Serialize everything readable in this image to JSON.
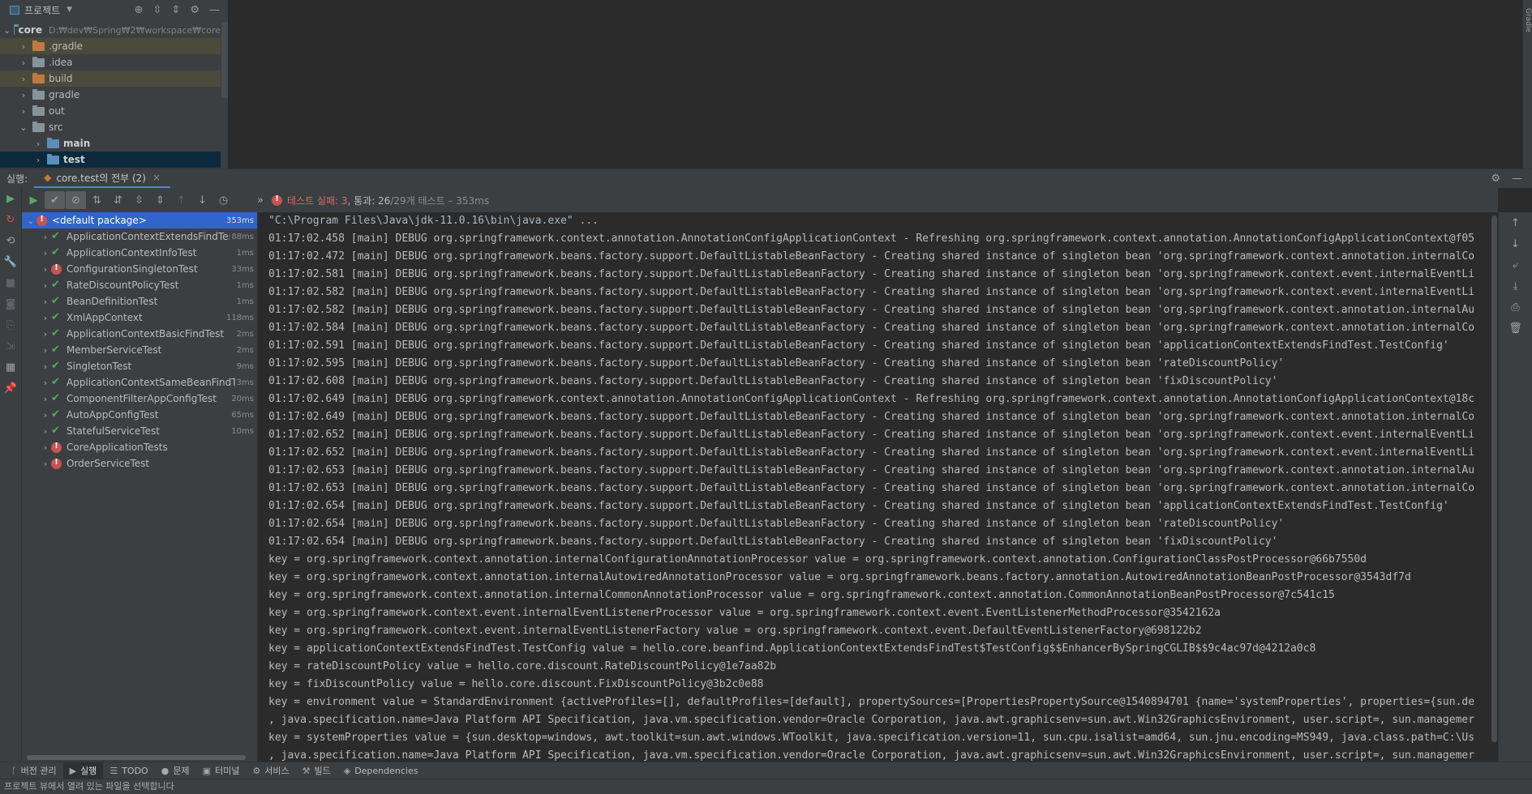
{
  "project_panel": {
    "title": "프로젝트",
    "tree": [
      {
        "label": "core",
        "path": "D:₩dev₩Spring₩2₩workspace₩core",
        "level": 0,
        "expanded": true,
        "folder": "blue",
        "bold": true
      },
      {
        "label": ".gradle",
        "level": 1,
        "expanded": false,
        "folder": "orange",
        "highlight": true
      },
      {
        "label": ".idea",
        "level": 1,
        "expanded": false,
        "folder": "gray"
      },
      {
        "label": "build",
        "level": 1,
        "expanded": false,
        "folder": "orange",
        "highlight": true
      },
      {
        "label": "gradle",
        "level": 1,
        "expanded": false,
        "folder": "gray"
      },
      {
        "label": "out",
        "level": 1,
        "expanded": false,
        "folder": "gray"
      },
      {
        "label": "src",
        "level": 1,
        "expanded": true,
        "folder": "gray"
      },
      {
        "label": "main",
        "level": 2,
        "expanded": false,
        "folder": "blue",
        "bold": true
      },
      {
        "label": "test",
        "level": 2,
        "expanded": false,
        "folder": "blue",
        "bold": true,
        "selected": true
      }
    ]
  },
  "right_strip": {
    "label": "Gradle"
  },
  "run_window": {
    "label": "실행:",
    "tab_label": "core.test의 전부 (2)",
    "status": {
      "failed": "테스트 실패: 3",
      "passed": ", 통과: 26",
      "total": " /29개 테스트 – 353ms"
    },
    "tests": [
      {
        "name": "<default package>",
        "time": "353ms",
        "status": "fail",
        "level": 0,
        "expanded": true,
        "selected": true
      },
      {
        "name": "ApplicationContextExtendsFindTest",
        "time": "88ms",
        "status": "pass",
        "level": 1
      },
      {
        "name": "ApplicationContextInfoTest",
        "time": "1ms",
        "status": "pass",
        "level": 1
      },
      {
        "name": "ConfigurationSingletonTest",
        "time": "33ms",
        "status": "fail",
        "level": 1
      },
      {
        "name": "RateDiscountPolicyTest",
        "time": "1ms",
        "status": "pass",
        "level": 1
      },
      {
        "name": "BeanDefinitionTest",
        "time": "1ms",
        "status": "pass",
        "level": 1
      },
      {
        "name": "XmlAppContext",
        "time": "118ms",
        "status": "pass",
        "level": 1
      },
      {
        "name": "ApplicationContextBasicFindTest",
        "time": "2ms",
        "status": "pass",
        "level": 1
      },
      {
        "name": "MemberServiceTest",
        "time": "2ms",
        "status": "pass",
        "level": 1
      },
      {
        "name": "SingletonTest",
        "time": "9ms",
        "status": "pass",
        "level": 1
      },
      {
        "name": "ApplicationContextSameBeanFindTest",
        "time": "3ms",
        "status": "pass",
        "level": 1
      },
      {
        "name": "ComponentFilterAppConfigTest",
        "time": "20ms",
        "status": "pass",
        "level": 1
      },
      {
        "name": "AutoAppConfigTest",
        "time": "65ms",
        "status": "pass",
        "level": 1
      },
      {
        "name": "StatefulServiceTest",
        "time": "10ms",
        "status": "pass",
        "level": 1
      },
      {
        "name": "CoreApplicationTests",
        "time": "",
        "status": "fail",
        "level": 1
      },
      {
        "name": "OrderServiceTest",
        "time": "",
        "status": "fail",
        "level": 1
      }
    ],
    "console": [
      "\"C:\\Program Files\\Java\\jdk-11.0.16\\bin\\java.exe\" ...",
      "01:17:02.458 [main] DEBUG org.springframework.context.annotation.AnnotationConfigApplicationContext - Refreshing org.springframework.context.annotation.AnnotationConfigApplicationContext@f05",
      "01:17:02.472 [main] DEBUG org.springframework.beans.factory.support.DefaultListableBeanFactory - Creating shared instance of singleton bean 'org.springframework.context.annotation.internalCo",
      "01:17:02.581 [main] DEBUG org.springframework.beans.factory.support.DefaultListableBeanFactory - Creating shared instance of singleton bean 'org.springframework.context.event.internalEventLi",
      "01:17:02.582 [main] DEBUG org.springframework.beans.factory.support.DefaultListableBeanFactory - Creating shared instance of singleton bean 'org.springframework.context.event.internalEventLi",
      "01:17:02.582 [main] DEBUG org.springframework.beans.factory.support.DefaultListableBeanFactory - Creating shared instance of singleton bean 'org.springframework.context.annotation.internalAu",
      "01:17:02.584 [main] DEBUG org.springframework.beans.factory.support.DefaultListableBeanFactory - Creating shared instance of singleton bean 'org.springframework.context.annotation.internalCo",
      "01:17:02.591 [main] DEBUG org.springframework.beans.factory.support.DefaultListableBeanFactory - Creating shared instance of singleton bean 'applicationContextExtendsFindTest.TestConfig'",
      "01:17:02.595 [main] DEBUG org.springframework.beans.factory.support.DefaultListableBeanFactory - Creating shared instance of singleton bean 'rateDiscountPolicy'",
      "01:17:02.608 [main] DEBUG org.springframework.beans.factory.support.DefaultListableBeanFactory - Creating shared instance of singleton bean 'fixDiscountPolicy'",
      "01:17:02.649 [main] DEBUG org.springframework.context.annotation.AnnotationConfigApplicationContext - Refreshing org.springframework.context.annotation.AnnotationConfigApplicationContext@18c",
      "01:17:02.649 [main] DEBUG org.springframework.beans.factory.support.DefaultListableBeanFactory - Creating shared instance of singleton bean 'org.springframework.context.annotation.internalCo",
      "01:17:02.652 [main] DEBUG org.springframework.beans.factory.support.DefaultListableBeanFactory - Creating shared instance of singleton bean 'org.springframework.context.event.internalEventLi",
      "01:17:02.652 [main] DEBUG org.springframework.beans.factory.support.DefaultListableBeanFactory - Creating shared instance of singleton bean 'org.springframework.context.event.internalEventLi",
      "01:17:02.653 [main] DEBUG org.springframework.beans.factory.support.DefaultListableBeanFactory - Creating shared instance of singleton bean 'org.springframework.context.annotation.internalAu",
      "01:17:02.653 [main] DEBUG org.springframework.beans.factory.support.DefaultListableBeanFactory - Creating shared instance of singleton bean 'org.springframework.context.annotation.internalCo",
      "01:17:02.654 [main] DEBUG org.springframework.beans.factory.support.DefaultListableBeanFactory - Creating shared instance of singleton bean 'applicationContextExtendsFindTest.TestConfig'",
      "01:17:02.654 [main] DEBUG org.springframework.beans.factory.support.DefaultListableBeanFactory - Creating shared instance of singleton bean 'rateDiscountPolicy'",
      "01:17:02.654 [main] DEBUG org.springframework.beans.factory.support.DefaultListableBeanFactory - Creating shared instance of singleton bean 'fixDiscountPolicy'",
      "key = org.springframework.context.annotation.internalConfigurationAnnotationProcessor value = org.springframework.context.annotation.ConfigurationClassPostProcessor@66b7550d",
      "key = org.springframework.context.annotation.internalAutowiredAnnotationProcessor value = org.springframework.beans.factory.annotation.AutowiredAnnotationBeanPostProcessor@3543df7d",
      "key = org.springframework.context.annotation.internalCommonAnnotationProcessor value = org.springframework.context.annotation.CommonAnnotationBeanPostProcessor@7c541c15",
      "key = org.springframework.context.event.internalEventListenerProcessor value = org.springframework.context.event.EventListenerMethodProcessor@3542162a",
      "key = org.springframework.context.event.internalEventListenerFactory value = org.springframework.context.event.DefaultEventListenerFactory@698122b2",
      "key = applicationContextExtendsFindTest.TestConfig value = hello.core.beanfind.ApplicationContextExtendsFindTest$TestConfig$$EnhancerBySpringCGLIB$$9c4ac97d@4212a0c8",
      "key = rateDiscountPolicy value = hello.core.discount.RateDiscountPolicy@1e7aa82b",
      "key = fixDiscountPolicy value = hello.core.discount.FixDiscountPolicy@3b2c0e88",
      "key = environment value = StandardEnvironment {activeProfiles=[], defaultProfiles=[default], propertySources=[PropertiesPropertySource@1540894701 {name='systemProperties', properties={sun.de",
      ", java.specification.name=Java Platform API Specification, java.vm.specification.vendor=Oracle Corporation, java.awt.graphicsenv=sun.awt.Win32GraphicsEnvironment, user.script=, sun.managemer",
      "key = systemProperties value = {sun.desktop=windows, awt.toolkit=sun.awt.windows.WToolkit, java.specification.version=11, sun.cpu.isalist=amd64, sun.jnu.encoding=MS949, java.class.path=C:\\Us",
      ", java.specification.name=Java Platform API Specification, java.vm.specification.vendor=Oracle Corporation, java.awt.graphicsenv=sun.awt.Win32GraphicsEnvironment, user.script=, sun.managemer"
    ]
  },
  "bottom_tabs": [
    {
      "label": "버전 관리",
      "icon": "branch-icon"
    },
    {
      "label": "실행",
      "icon": "play-icon",
      "active": true
    },
    {
      "label": "TODO",
      "icon": "list-icon"
    },
    {
      "label": "문제",
      "icon": "info-icon"
    },
    {
      "label": "터미널",
      "icon": "terminal-icon"
    },
    {
      "label": "서비스",
      "icon": "services-icon"
    },
    {
      "label": "빌드",
      "icon": "hammer-icon"
    },
    {
      "label": "Dependencies",
      "icon": "dependencies-icon"
    }
  ],
  "status_bar": {
    "text": "프로젝트 뷰에서 열려 있는 파일을 선택합니다"
  },
  "colors": {
    "accent": "#2f65ca",
    "pass": "#59a869",
    "fail": "#c75450",
    "panel": "#3c3f41",
    "editor": "#2b2b2b"
  }
}
